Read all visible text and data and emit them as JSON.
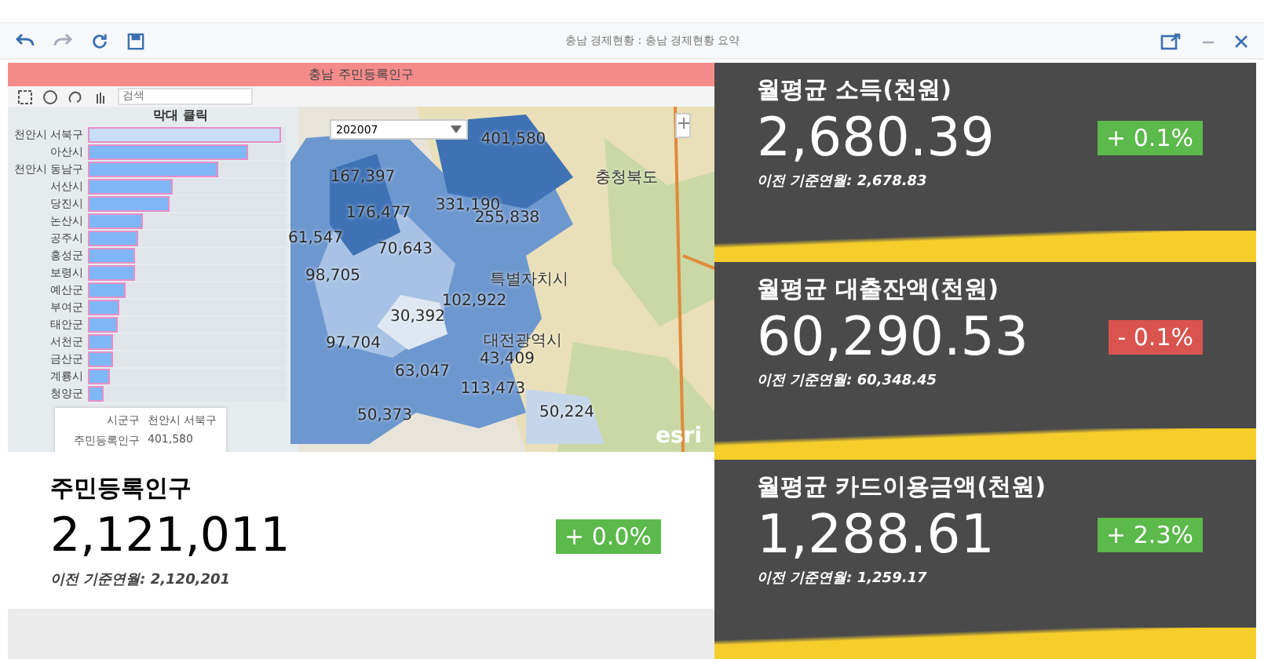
{
  "window": {
    "title": "충남 경제현황 : 충남 경제현황 요약"
  },
  "map_panel": {
    "header": "충남 주민등록인구",
    "search": {
      "placeholder": "검색"
    },
    "period_select": "202007",
    "chart_title": "막대 클릭",
    "bars": [
      {
        "label": "천안시 서북구",
        "level": 0.98,
        "selected": true
      },
      {
        "label": "아산시",
        "level": 0.81,
        "selected": false
      },
      {
        "label": "천안시 동남구",
        "level": 0.66,
        "selected": false
      },
      {
        "label": "서산시",
        "level": 0.43,
        "selected": false
      },
      {
        "label": "당진시",
        "level": 0.41,
        "selected": false
      },
      {
        "label": "논산시",
        "level": 0.28,
        "selected": false
      },
      {
        "label": "공주시",
        "level": 0.25,
        "selected": false
      },
      {
        "label": "홍성군",
        "level": 0.24,
        "selected": false
      },
      {
        "label": "보령시",
        "level": 0.24,
        "selected": false
      },
      {
        "label": "예산군",
        "level": 0.19,
        "selected": false
      },
      {
        "label": "부여군",
        "level": 0.16,
        "selected": false
      },
      {
        "label": "태안군",
        "level": 0.15,
        "selected": false
      },
      {
        "label": "서천군",
        "level": 0.13,
        "selected": false
      },
      {
        "label": "금산군",
        "level": 0.13,
        "selected": false
      },
      {
        "label": "계룡시",
        "level": 0.11,
        "selected": false
      },
      {
        "label": "청양군",
        "level": 0.08,
        "selected": false
      }
    ],
    "tooltip": [
      {
        "key": "시군구",
        "value": "천안시 서북구"
      },
      {
        "key": "주민등록인구",
        "value": "401,580"
      }
    ],
    "map_labels": [
      {
        "text": "167,397",
        "kind": "value"
      },
      {
        "text": "401,580",
        "kind": "value"
      },
      {
        "text": "176,477",
        "kind": "value"
      },
      {
        "text": "331,190",
        "kind": "value"
      },
      {
        "text": "61,547",
        "kind": "value"
      },
      {
        "text": "255,838",
        "kind": "value"
      },
      {
        "text": "70,643",
        "kind": "value"
      },
      {
        "text": "98,705",
        "kind": "value"
      },
      {
        "text": "102,922",
        "kind": "value"
      },
      {
        "text": "30,392",
        "kind": "value"
      },
      {
        "text": "97,704",
        "kind": "value"
      },
      {
        "text": "43,409",
        "kind": "value"
      },
      {
        "text": "63,047",
        "kind": "value"
      },
      {
        "text": "113,473",
        "kind": "value"
      },
      {
        "text": "50,373",
        "kind": "value"
      },
      {
        "text": "50,224",
        "kind": "value"
      },
      {
        "text": "충청북도",
        "kind": "place"
      },
      {
        "text": "특별자치시",
        "kind": "place"
      },
      {
        "text": "대전광역시",
        "kind": "place"
      }
    ],
    "attribution": "esri"
  },
  "summary_card": {
    "title": "주민등록인구",
    "value": "2,121,011",
    "change": "+ 0.0%",
    "negative": false,
    "previous": "이전 기준연월: 2,120,201"
  },
  "side_cards": [
    {
      "title": "월평균 소득(천원)",
      "value": "2,680.39",
      "change": "+ 0.1%",
      "negative": false,
      "previous": "이전 기준연월: 2,678.83"
    },
    {
      "title": "월평균 대출잔액(천원)",
      "value": "60,290.53",
      "change": "- 0.1%",
      "negative": true,
      "previous": "이전 기준연월: 60,348.45"
    },
    {
      "title": "월평균 카드이용금액(천원)",
      "value": "1,288.61",
      "change": "+ 2.3%",
      "negative": false,
      "previous": "이전 기준연월: 1,259.17"
    }
  ]
}
